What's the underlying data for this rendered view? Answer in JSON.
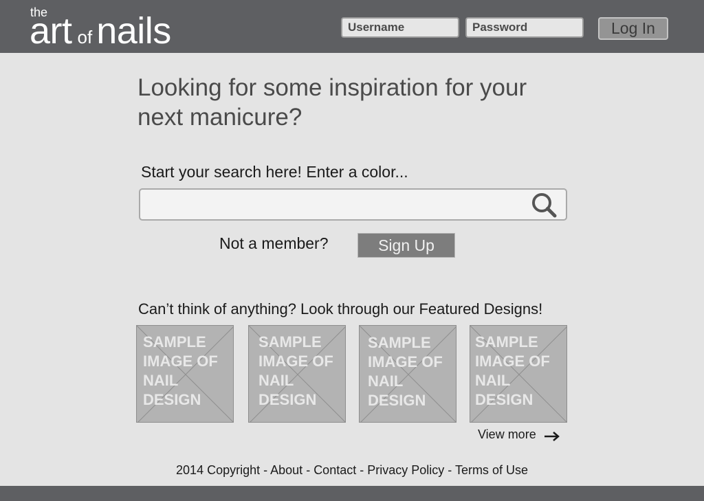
{
  "header": {
    "logo": {
      "the": "the",
      "art": "art",
      "of": "of",
      "nails": "nails"
    },
    "username_placeholder": "Username",
    "password_placeholder": "Password",
    "login_label": "Log In"
  },
  "main": {
    "headline": "Looking for some inspiration for your next manicure?",
    "search_label": "Start your search here! Enter a color...",
    "search_value": "",
    "not_member": "Not a member?",
    "signup_label": "Sign Up",
    "featured_label": "Can’t think of anything? Look through our Featured Designs!",
    "featured_designs": [
      {
        "text": "SAMPLE IMAGE OF NAIL DESIGN"
      },
      {
        "text": "SAMPLE IMAGE OF NAIL DESIGN"
      },
      {
        "text": "SAMPLE IMAGE OF NAIL DESIGN"
      },
      {
        "text": "SAMPLE IMAGE OF NAIL DESIGN"
      }
    ],
    "view_more": "View more"
  },
  "footer": {
    "copyright": "2014 Copyright",
    "separator": " - ",
    "links": [
      "About",
      "Contact",
      "Privacy Policy",
      "Terms of Use"
    ]
  },
  "icons": {
    "search": "search-icon",
    "view_more": "arrow-right-icon",
    "thumbnail_placeholder": "image-placeholder-icon"
  },
  "colors": {
    "header_bg": "#5e5f62",
    "page_bg": "#e4e4e4",
    "signup_bg": "#7d7d7d",
    "thumb_bg": "#b3b3b3"
  }
}
